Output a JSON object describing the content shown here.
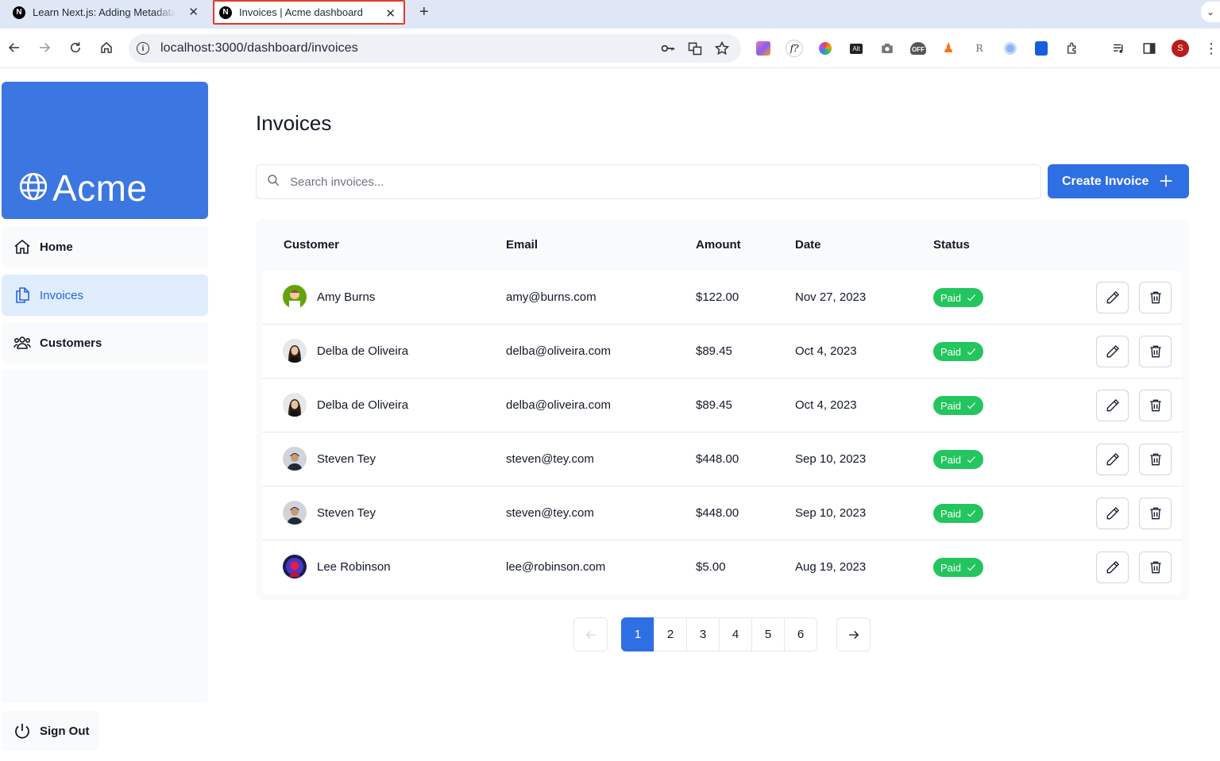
{
  "browser": {
    "tabs": [
      {
        "label": "Learn Next.js: Adding Metadata",
        "favicon": "N"
      },
      {
        "label": "Invoices | Acme dashboard",
        "favicon": "N"
      }
    ],
    "new_tab": "+",
    "url": "localhost:3000/dashboard/invoices",
    "profile_initial": "S",
    "ext_off_label": "OFF",
    "ext_alt_label": "Alt"
  },
  "sidebar": {
    "logo_text": "Acme",
    "items": [
      {
        "label": "Home",
        "icon": "home-icon"
      },
      {
        "label": "Invoices",
        "icon": "document-duplicate-icon",
        "active": true
      },
      {
        "label": "Customers",
        "icon": "user-group-icon"
      }
    ],
    "sign_out": "Sign Out"
  },
  "main": {
    "title": "Invoices",
    "search_placeholder": "Search invoices...",
    "create_button": "Create Invoice",
    "columns": [
      "Customer",
      "Email",
      "Amount",
      "Date",
      "Status"
    ],
    "rows": [
      {
        "name": "Amy Burns",
        "email": "amy@burns.com",
        "amount": "$122.00",
        "date": "Nov 27, 2023",
        "status": "Paid"
      },
      {
        "name": "Delba de Oliveira",
        "email": "delba@oliveira.com",
        "amount": "$89.45",
        "date": "Oct 4, 2023",
        "status": "Paid"
      },
      {
        "name": "Delba de Oliveira",
        "email": "delba@oliveira.com",
        "amount": "$89.45",
        "date": "Oct 4, 2023",
        "status": "Paid"
      },
      {
        "name": "Steven Tey",
        "email": "steven@tey.com",
        "amount": "$448.00",
        "date": "Sep 10, 2023",
        "status": "Paid"
      },
      {
        "name": "Steven Tey",
        "email": "steven@tey.com",
        "amount": "$448.00",
        "date": "Sep 10, 2023",
        "status": "Paid"
      },
      {
        "name": "Lee Robinson",
        "email": "lee@robinson.com",
        "amount": "$5.00",
        "date": "Aug 19, 2023",
        "status": "Paid"
      }
    ],
    "pagination": {
      "pages": [
        "1",
        "2",
        "3",
        "4",
        "5",
        "6"
      ],
      "current": "1"
    }
  },
  "colors": {
    "accent": "#2f6fe4",
    "logo_bg": "#3b76e1",
    "paid": "#22c55e",
    "active_nav_bg": "#e0edfd"
  }
}
